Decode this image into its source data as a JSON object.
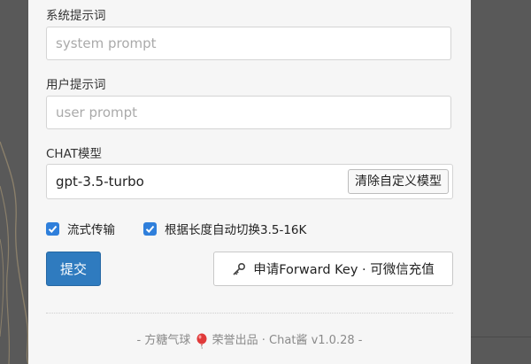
{
  "form": {
    "system_prompt_label": "系统提示词",
    "system_prompt_placeholder": "system prompt",
    "user_prompt_label": "用户提示词",
    "user_prompt_placeholder": "user prompt",
    "model_label": "CHAT模型",
    "model_value": "gpt-3.5-turbo",
    "clear_model_button": "清除自定义模型",
    "stream_checkbox": {
      "label": "流式传输",
      "checked": true
    },
    "auto_switch_checkbox": {
      "label": "根据长度自动切换3.5-16K",
      "checked": true
    },
    "submit_button": "提交",
    "forward_key_button": "申请Forward Key · 可微信充值"
  },
  "footer": {
    "prefix": "- 方糖气球",
    "suffix": "荣誉出品 · Chat酱 v1.0.28 -"
  },
  "colors": {
    "primary": "#2f7bbf",
    "checkbox": "#2f7fdb",
    "panel_bg": "#f6f6f6",
    "page_bg": "#595959"
  },
  "icons": {
    "key": "key-icon",
    "balloon": "balloon-icon",
    "check": "check-icon"
  }
}
